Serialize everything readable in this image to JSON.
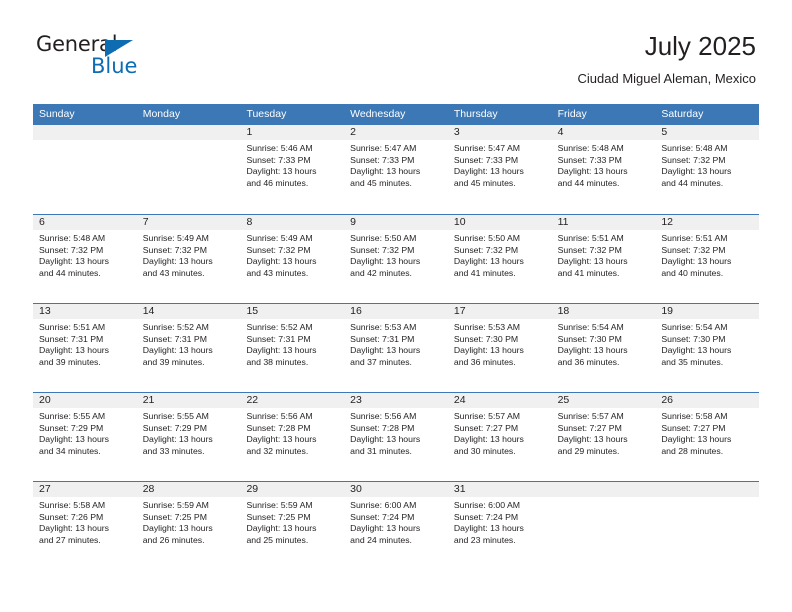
{
  "logo": {
    "word_one": "General",
    "word_two": "Blue",
    "triangle_icon": "blue-triangle-icon",
    "accent_color": "#0d6cb2"
  },
  "header": {
    "title": "July 2025",
    "subtitle": "Ciudad Miguel Aleman, Mexico"
  },
  "colors": {
    "header_blue": "#3b78b5",
    "daynum_band": "#f0f0f0",
    "text": "#231f20"
  },
  "weekday_headers": [
    "Sunday",
    "Monday",
    "Tuesday",
    "Wednesday",
    "Thursday",
    "Friday",
    "Saturday"
  ],
  "labels": {
    "sunrise_prefix": "Sunrise:",
    "sunset_prefix": "Sunset:",
    "daylight_prefix": "Daylight:"
  },
  "weeks": [
    [
      {
        "day": "",
        "lines": []
      },
      {
        "day": "",
        "lines": []
      },
      {
        "day": "1",
        "lines": [
          "Sunrise: 5:46 AM",
          "Sunset: 7:33 PM",
          "Daylight: 13 hours",
          "and 46 minutes."
        ]
      },
      {
        "day": "2",
        "lines": [
          "Sunrise: 5:47 AM",
          "Sunset: 7:33 PM",
          "Daylight: 13 hours",
          "and 45 minutes."
        ]
      },
      {
        "day": "3",
        "lines": [
          "Sunrise: 5:47 AM",
          "Sunset: 7:33 PM",
          "Daylight: 13 hours",
          "and 45 minutes."
        ]
      },
      {
        "day": "4",
        "lines": [
          "Sunrise: 5:48 AM",
          "Sunset: 7:33 PM",
          "Daylight: 13 hours",
          "and 44 minutes."
        ]
      },
      {
        "day": "5",
        "lines": [
          "Sunrise: 5:48 AM",
          "Sunset: 7:32 PM",
          "Daylight: 13 hours",
          "and 44 minutes."
        ]
      }
    ],
    [
      {
        "day": "6",
        "lines": [
          "Sunrise: 5:48 AM",
          "Sunset: 7:32 PM",
          "Daylight: 13 hours",
          "and 44 minutes."
        ]
      },
      {
        "day": "7",
        "lines": [
          "Sunrise: 5:49 AM",
          "Sunset: 7:32 PM",
          "Daylight: 13 hours",
          "and 43 minutes."
        ]
      },
      {
        "day": "8",
        "lines": [
          "Sunrise: 5:49 AM",
          "Sunset: 7:32 PM",
          "Daylight: 13 hours",
          "and 43 minutes."
        ]
      },
      {
        "day": "9",
        "lines": [
          "Sunrise: 5:50 AM",
          "Sunset: 7:32 PM",
          "Daylight: 13 hours",
          "and 42 minutes."
        ]
      },
      {
        "day": "10",
        "lines": [
          "Sunrise: 5:50 AM",
          "Sunset: 7:32 PM",
          "Daylight: 13 hours",
          "and 41 minutes."
        ]
      },
      {
        "day": "11",
        "lines": [
          "Sunrise: 5:51 AM",
          "Sunset: 7:32 PM",
          "Daylight: 13 hours",
          "and 41 minutes."
        ]
      },
      {
        "day": "12",
        "lines": [
          "Sunrise: 5:51 AM",
          "Sunset: 7:32 PM",
          "Daylight: 13 hours",
          "and 40 minutes."
        ]
      }
    ],
    [
      {
        "day": "13",
        "lines": [
          "Sunrise: 5:51 AM",
          "Sunset: 7:31 PM",
          "Daylight: 13 hours",
          "and 39 minutes."
        ]
      },
      {
        "day": "14",
        "lines": [
          "Sunrise: 5:52 AM",
          "Sunset: 7:31 PM",
          "Daylight: 13 hours",
          "and 39 minutes."
        ]
      },
      {
        "day": "15",
        "lines": [
          "Sunrise: 5:52 AM",
          "Sunset: 7:31 PM",
          "Daylight: 13 hours",
          "and 38 minutes."
        ]
      },
      {
        "day": "16",
        "lines": [
          "Sunrise: 5:53 AM",
          "Sunset: 7:31 PM",
          "Daylight: 13 hours",
          "and 37 minutes."
        ]
      },
      {
        "day": "17",
        "lines": [
          "Sunrise: 5:53 AM",
          "Sunset: 7:30 PM",
          "Daylight: 13 hours",
          "and 36 minutes."
        ]
      },
      {
        "day": "18",
        "lines": [
          "Sunrise: 5:54 AM",
          "Sunset: 7:30 PM",
          "Daylight: 13 hours",
          "and 36 minutes."
        ]
      },
      {
        "day": "19",
        "lines": [
          "Sunrise: 5:54 AM",
          "Sunset: 7:30 PM",
          "Daylight: 13 hours",
          "and 35 minutes."
        ]
      }
    ],
    [
      {
        "day": "20",
        "lines": [
          "Sunrise: 5:55 AM",
          "Sunset: 7:29 PM",
          "Daylight: 13 hours",
          "and 34 minutes."
        ]
      },
      {
        "day": "21",
        "lines": [
          "Sunrise: 5:55 AM",
          "Sunset: 7:29 PM",
          "Daylight: 13 hours",
          "and 33 minutes."
        ]
      },
      {
        "day": "22",
        "lines": [
          "Sunrise: 5:56 AM",
          "Sunset: 7:28 PM",
          "Daylight: 13 hours",
          "and 32 minutes."
        ]
      },
      {
        "day": "23",
        "lines": [
          "Sunrise: 5:56 AM",
          "Sunset: 7:28 PM",
          "Daylight: 13 hours",
          "and 31 minutes."
        ]
      },
      {
        "day": "24",
        "lines": [
          "Sunrise: 5:57 AM",
          "Sunset: 7:27 PM",
          "Daylight: 13 hours",
          "and 30 minutes."
        ]
      },
      {
        "day": "25",
        "lines": [
          "Sunrise: 5:57 AM",
          "Sunset: 7:27 PM",
          "Daylight: 13 hours",
          "and 29 minutes."
        ]
      },
      {
        "day": "26",
        "lines": [
          "Sunrise: 5:58 AM",
          "Sunset: 7:27 PM",
          "Daylight: 13 hours",
          "and 28 minutes."
        ]
      }
    ],
    [
      {
        "day": "27",
        "lines": [
          "Sunrise: 5:58 AM",
          "Sunset: 7:26 PM",
          "Daylight: 13 hours",
          "and 27 minutes."
        ]
      },
      {
        "day": "28",
        "lines": [
          "Sunrise: 5:59 AM",
          "Sunset: 7:25 PM",
          "Daylight: 13 hours",
          "and 26 minutes."
        ]
      },
      {
        "day": "29",
        "lines": [
          "Sunrise: 5:59 AM",
          "Sunset: 7:25 PM",
          "Daylight: 13 hours",
          "and 25 minutes."
        ]
      },
      {
        "day": "30",
        "lines": [
          "Sunrise: 6:00 AM",
          "Sunset: 7:24 PM",
          "Daylight: 13 hours",
          "and 24 minutes."
        ]
      },
      {
        "day": "31",
        "lines": [
          "Sunrise: 6:00 AM",
          "Sunset: 7:24 PM",
          "Daylight: 13 hours",
          "and 23 minutes."
        ]
      },
      {
        "day": "",
        "lines": []
      },
      {
        "day": "",
        "lines": []
      }
    ]
  ]
}
